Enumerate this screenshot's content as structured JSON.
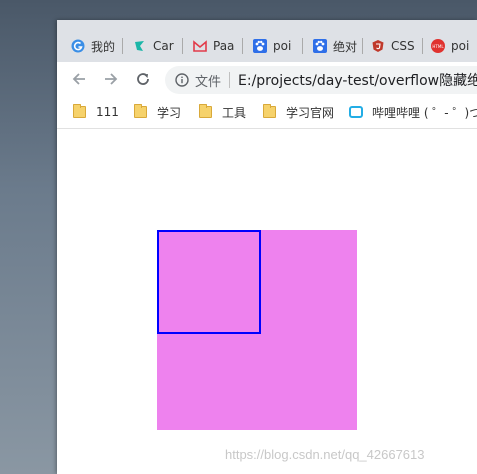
{
  "tabs": [
    {
      "label": "我的",
      "icon": "browser-logo-icon"
    },
    {
      "label": "Car",
      "icon": "teal-logo-icon"
    },
    {
      "label": "Paa",
      "icon": "mail-logo-icon"
    },
    {
      "label": "poi",
      "icon": "baidu-paw-icon"
    },
    {
      "label": "绝对",
      "icon": "baidu-paw-icon"
    },
    {
      "label": "CSS",
      "icon": "shield-logo-icon"
    },
    {
      "label": "poi",
      "icon": "html-badge-icon"
    }
  ],
  "html_badge_text": "HTML",
  "omnibox": {
    "file_label": "文件",
    "url": "E:/projects/day-test/overflow隐藏绝"
  },
  "bookmarks": [
    {
      "label": "111",
      "icon": "folder-icon"
    },
    {
      "label": "学习",
      "icon": "folder-icon"
    },
    {
      "label": "工具",
      "icon": "folder-icon"
    },
    {
      "label": "学习官网",
      "icon": "folder-icon"
    },
    {
      "label": "哔哩哔哩 ( ゜- ゜)つ...",
      "icon": "bilibili-icon"
    }
  ],
  "page": {
    "outer_color": "#ee82ee",
    "inner_border_color": "#0000ff"
  },
  "watermark": "https://blog.csdn.net/qq_42667613"
}
